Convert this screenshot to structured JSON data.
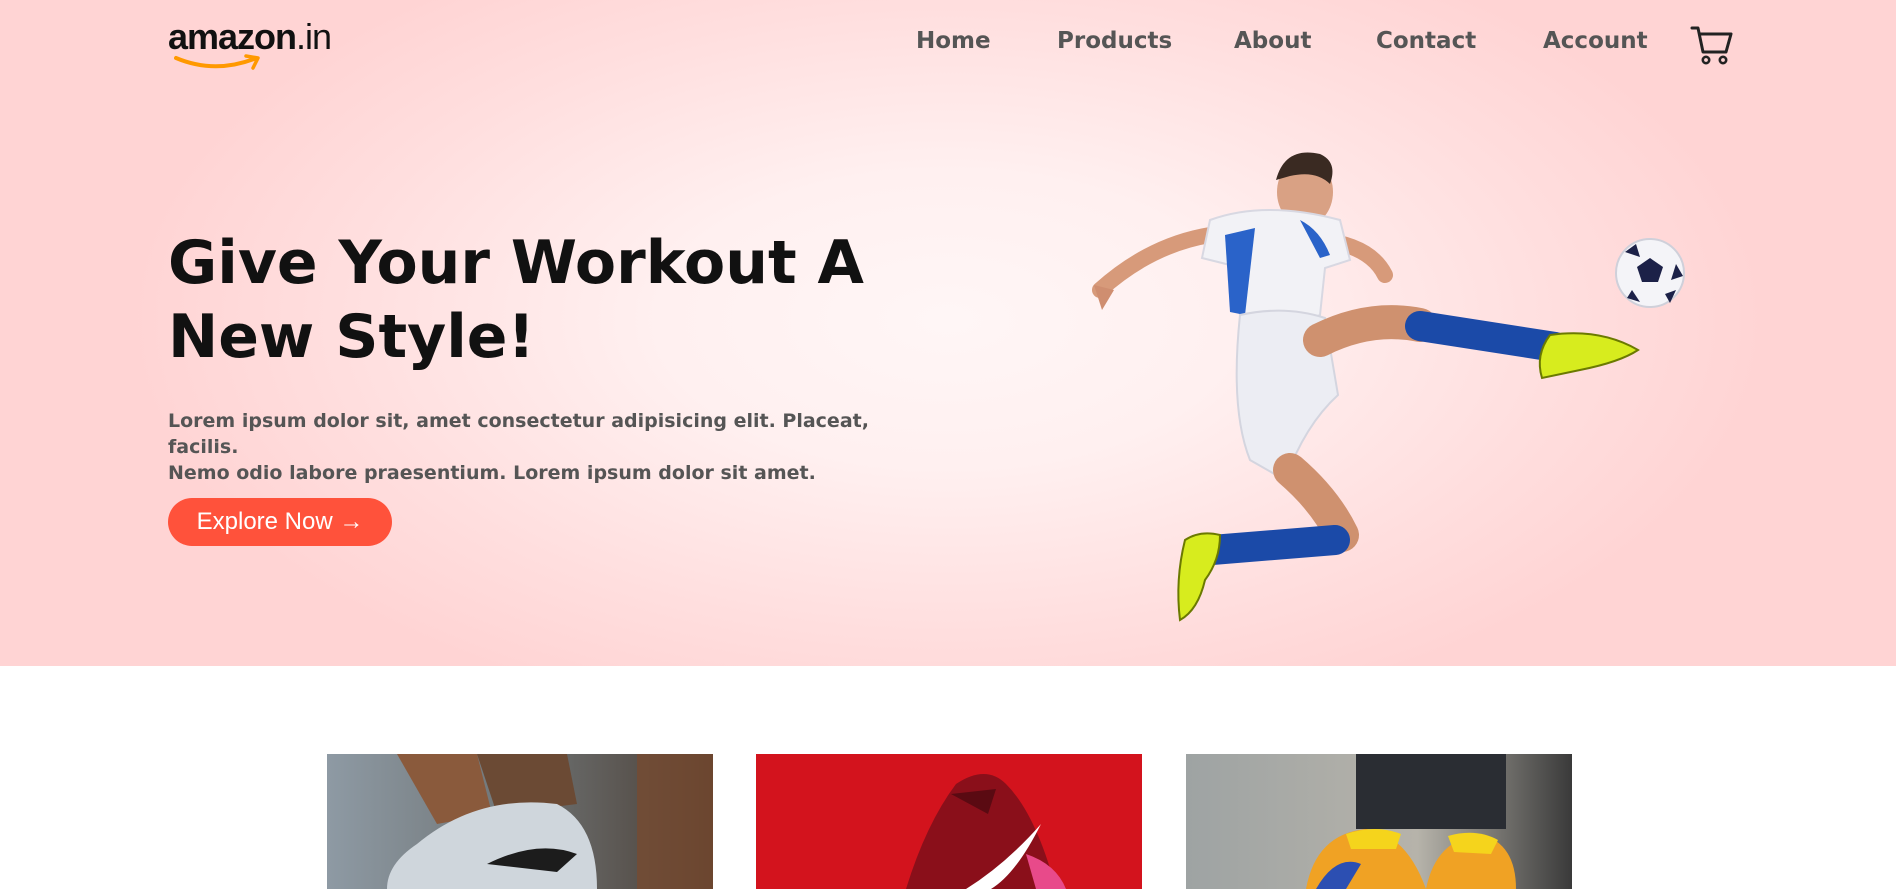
{
  "brand": {
    "logo_text_bold": "amazon",
    "logo_text_suffix": ".in",
    "accent_color": "#ff523b",
    "smile_color": "#ff9900"
  },
  "nav": {
    "items": [
      {
        "label": "Home"
      },
      {
        "label": "Products"
      },
      {
        "label": "About"
      },
      {
        "label": "Contact"
      },
      {
        "label": "Account"
      }
    ],
    "cart_icon": "cart-icon"
  },
  "hero": {
    "headline_line1": "Give Your Workout A",
    "headline_line2": "New Style!",
    "lead_line1": "Lorem ipsum dolor sit, amet consectetur adipisicing elit. Placeat, facilis.",
    "lead_line2": "Nemo odio labore praesentium. Lorem ipsum dolor sit amet.",
    "cta_label": "Explore Now →",
    "image": "soccer-player-kicking-ball"
  },
  "products": {
    "cards": [
      {
        "image": "grey-sneaker"
      },
      {
        "image": "red-nike-shoe"
      },
      {
        "image": "yellow-orange-sneakers"
      }
    ]
  }
}
